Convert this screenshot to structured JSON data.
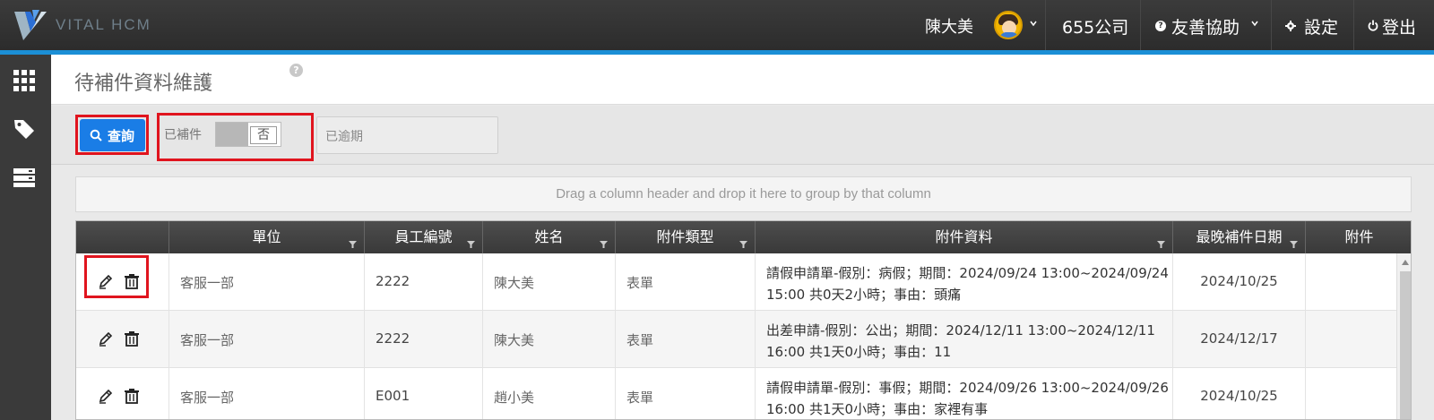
{
  "app": {
    "brand": "VITAL HCM",
    "user_name": "陳大美",
    "company": "655公司",
    "help_label": "友善協助",
    "settings_label": "設定",
    "logout_label": "登出",
    "accent_color": "#1b8fd6"
  },
  "sidebar": {
    "items": [
      {
        "icon": "apps-grid-icon"
      },
      {
        "icon": "tag-icon"
      },
      {
        "icon": "server-icon"
      }
    ]
  },
  "page": {
    "title": "待補件資料維護",
    "help_icon": "?"
  },
  "toolbar": {
    "query_label": "查詢",
    "filter_supplemented_label": "已補件",
    "filter_supplemented_value": "否",
    "overdue_placeholder": "已逾期",
    "highlight_color": "#e0141e"
  },
  "grid": {
    "group_hint": "Drag a column header and drop it here to group by that column",
    "columns": [
      "",
      "單位",
      "員工編號",
      "姓名",
      "附件類型",
      "附件資料",
      "最晚補件日期",
      "附件"
    ],
    "rows": [
      {
        "dept": "客服一部",
        "emp_id": "2222",
        "name": "陳大美",
        "type": "表單",
        "detail": "請假申請單-假別：病假；期間：2024/09/24 13:00~2024/09/24 15:00 共0天2小時；事由：頭痛",
        "deadline": "2024/10/25",
        "attachment": ""
      },
      {
        "dept": "客服一部",
        "emp_id": "2222",
        "name": "陳大美",
        "type": "表單",
        "detail": "出差申請-假別：公出；期間：2024/12/11 13:00~2024/12/11 16:00 共1天0小時；事由：11",
        "deadline": "2024/12/17",
        "attachment": ""
      },
      {
        "dept": "客服一部",
        "emp_id": "E001",
        "name": "趙小美",
        "type": "表單",
        "detail": "請假申請單-假別：事假；期間：2024/09/26 13:00~2024/09/26 16:00 共1天0小時；事由：家裡有事",
        "deadline": "2024/10/25",
        "attachment": ""
      }
    ]
  }
}
